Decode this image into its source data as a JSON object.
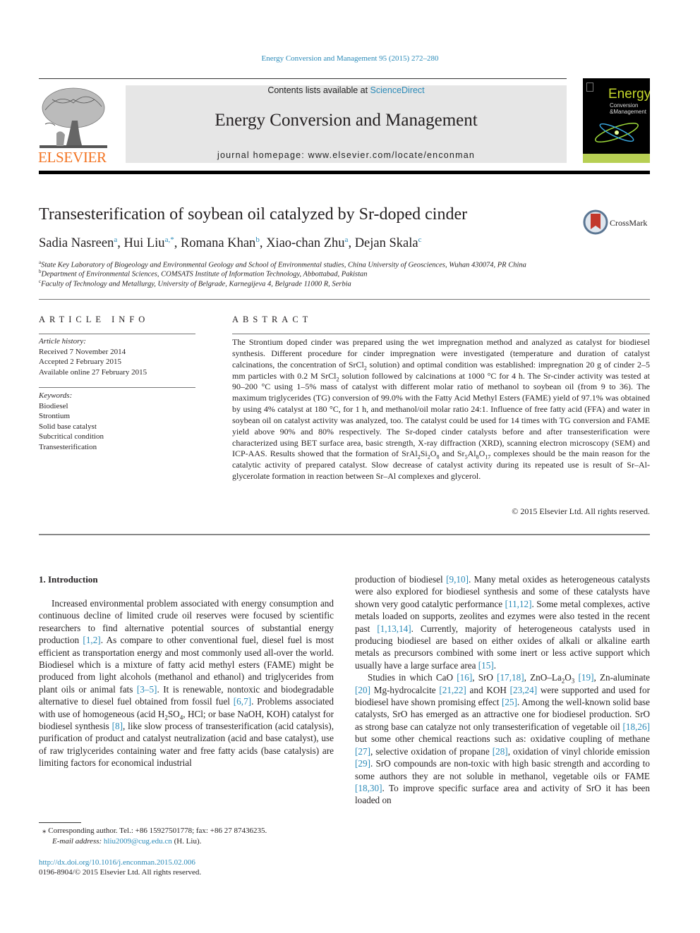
{
  "header": {
    "journal_ref": "Energy Conversion and Management 95 (2015) 272–280",
    "contents_prefix": "Contents lists available at ",
    "contents_link": "ScienceDirect",
    "journal_title": "Energy Conversion and Management",
    "homepage_prefix": "journal homepage: ",
    "homepage_url": "www.elsevier.com/locate/enconman",
    "publisher_logo_text": "ELSEVIER",
    "cover": {
      "line1": "Energy",
      "line2": "Conversion",
      "line3": "&Management"
    },
    "publisher_color": "#f37321",
    "link_color": "#2a8ab8"
  },
  "article": {
    "title": "Transesterification of soybean oil catalyzed by Sr-doped cinder",
    "crossmark_label": "CrossMark",
    "authors": [
      {
        "name": "Sadia Nasreen",
        "sup": "a"
      },
      {
        "name": "Hui Liu",
        "sup": "a,*"
      },
      {
        "name": "Romana Khan",
        "sup": "b"
      },
      {
        "name": "Xiao-chan Zhu",
        "sup": "a"
      },
      {
        "name": "Dejan Skala",
        "sup": "c"
      }
    ],
    "affiliations": [
      {
        "key": "a",
        "text": "State Key Laboratory of Biogeology and Environmental Geology and School of Environmental studies, China University of Geosciences, Wuhan 430074, PR China"
      },
      {
        "key": "b",
        "text": "Department of Environmental Sciences, COMSATS Institute of Information Technology, Abbottabad, Pakistan"
      },
      {
        "key": "c",
        "text": "Faculty of Technology and Metallurgy, University of Belgrade, Karnegijeva 4, Belgrade 11000 R, Serbia"
      }
    ]
  },
  "article_info": {
    "heading": "ARTICLE INFO",
    "history_label": "Article history:",
    "history": [
      "Received 7 November 2014",
      "Accepted 2 February 2015",
      "Available online 27 February 2015"
    ],
    "keywords_label": "Keywords:",
    "keywords": [
      "Biodiesel",
      "Strontium",
      "Solid base catalyst",
      "Subcritical condition",
      "Transesterification"
    ]
  },
  "abstract": {
    "heading": "ABSTRACT",
    "p1": "The Strontium doped cinder was prepared using the wet impregnation method and analyzed as catalyst for biodiesel synthesis. Different procedure for cinder impregnation were investigated (temperature and duration of catalyst calcinations, the concentration of SrCl",
    "p2": " solution) and optimal condition was established: impregnation 20 g of cinder 2–5 mm particles with 0.2 M SrCl",
    "p3": " solution followed by calcinations at 1000 °C for 4 h. The Sr-cinder activity was tested at 90–200 °C using 1–5% mass of catalyst with different molar ratio of methanol to soybean oil (from 9 to 36). The maximum triglycerides (TG) conversion of 99.0% with the Fatty Acid Methyl Esters (FAME) yield of 97.1% was obtained by using 4% catalyst at 180 °C, for 1 h, and methanol/oil molar ratio 24:1. Influence of free fatty acid (FFA) and water in soybean oil on catalyst activity was analyzed, too. The catalyst could be used for 14 times with TG conversion and FAME yield above 90% and 80% respectively. The Sr-doped cinder catalysts before and after transesterification were characterized using BET surface area, basic strength, X-ray diffraction (XRD), scanning electron microscopy (SEM) and ICP-AAS. Results showed that the formation of SrAl",
    "p4": "Si",
    "p5": "O",
    "p6": " and Sr",
    "p7": "Al",
    "p8": "O",
    "p9": " complexes should be the main reason for the catalytic activity of prepared catalyst. Slow decrease of catalyst activity during its repeated use is result of Sr–Al-glycerolate formation in reaction between Sr–Al complexes and glycerol.",
    "sub_2": "2",
    "sub_8": "8",
    "sub_5": "5",
    "sub_17": "17",
    "copyright": "© 2015 Elsevier Ltd. All rights reserved."
  },
  "body": {
    "intro_heading": "1. Introduction",
    "left": {
      "s1": "Increased environmental problem associated with energy consumption and continuous decline of limited crude oil reserves were focused by scientific researchers to find alterna­tive potential sources of substantial energy production ",
      "r1": "[1,2]",
      "s2": ". As compare to other conventional fuel, diesel fuel is most effi­cient as transportation energy and most commonly used all-over the world. Biodiesel which is a mixture of fatty acid methyl esters (FAME) might be produced from light alcohols (methanol and ethanol) and triglycerides from plant oils or ani­mal fats ",
      "r2": "[3–5]",
      "s3": ". It is renewable, nontoxic and biodegradable alternative to diesel fuel obtained from fossil fuel ",
      "r3": "[6,7]",
      "s4": ". Prob­lems associated with use of homogeneous (acid H",
      "sub_2": "2",
      "s5": "SO",
      "sub_4": "4",
      "s6": ", HCl; or base NaOH, KOH) catalyst for biodiesel synthesis ",
      "r4": "[8]",
      "s7": ", like slow process of transesterification (acid catalysis), purification of product and catalyst neutralization (acid and base catalyst), use of raw triglycerides containing water and free fatty acids (base catalysis) are limiting factors for economical industrial"
    },
    "right": {
      "a1": "production of biodiesel ",
      "ar1": "[9,10]",
      "a2": ". Many metal oxides as heteroge­neous catalysts were also explored for biodiesel synthesis and some of these catalysts have shown very good catalytic perfor­mance ",
      "ar2": "[11,12]",
      "a3": ". Some metal complexes, active metals loaded on supports, zeolites and ezymes were also tested in the recent past ",
      "ar3": "[1,13,14]",
      "a4": ". Currently, majority of heterogeneous catalysts used in producing biodiesel are based on either oxides of alkali or alkaline earth metals as precursors combined with some inert or less active support which usually have a large surface area ",
      "ar4": "[15]",
      "a5": ".",
      "b1": "Studies in which CaO ",
      "br1": "[16]",
      "b2": ", SrO ",
      "br2": "[17,18]",
      "b3": ", ZnO–La",
      "bsub2": "2",
      "b3b": "O",
      "bsub3": "3",
      "b3c": " ",
      "br3": "[19]",
      "b4": ", Zn-aluminate ",
      "br4": "[20]",
      "b5": " Mg-hydrocalcite ",
      "br5": "[21,22]",
      "b6": " and KOH ",
      "br6": "[23,24]",
      "b7": " were sup­ported and used for biodiesel have shown promising effect ",
      "br7": "[25]",
      "b8": ". Among the well-known solid base catalysts, SrO has emerged as an attractive one for biodiesel production. SrO as strong base can catalyze not only transesterification of vegetable oil ",
      "br8": "[18,26]",
      "b9": " but some other chemical reactions such as: oxidative coupling of methane ",
      "br9": "[27]",
      "b10": ", selective oxidation of propane ",
      "br10": "[28]",
      "b11": ", oxidation of vinyl chloride emission ",
      "br11": "[29]",
      "b12": ". SrO compounds are non-toxic with high basic strength and according to some authors they are not sol­uble in methanol, vegetable oils or FAME ",
      "br12": "[18,30]",
      "b13": ". To improve specific surface area and activity of SrO it has been loaded on"
    }
  },
  "footnotes": {
    "corresponding": "⁎ Corresponding author. Tel.: +86 15927501778; fax: +86 27 87436235.",
    "email_label": "E-mail address: ",
    "email": "hliu2009@cug.edu.cn",
    "email_suffix": " (H. Liu).",
    "doi": "http://dx.doi.org/10.1016/j.enconman.2015.02.006",
    "issn": "0196-8904/© 2015 Elsevier Ltd. All rights reserved."
  }
}
